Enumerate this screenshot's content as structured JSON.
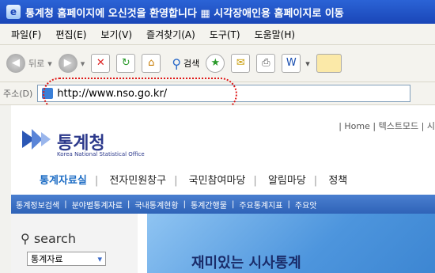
{
  "window": {
    "title": "통계청 홈페이지에 오신것을 환영합니다 ▦ 시각장애인용 홈페이지로 이동"
  },
  "menubar": {
    "items": [
      "파일(F)",
      "편집(E)",
      "보기(V)",
      "즐겨찾기(A)",
      "도구(T)",
      "도움말(H)"
    ]
  },
  "toolbar": {
    "back_label": "뒤로",
    "search_label": "검색"
  },
  "address": {
    "label": "주소(D)",
    "url": "http://www.nso.go.kr/"
  },
  "site": {
    "toplinks": "| Home | 텍스트모드 | 시",
    "logo_name": "통계청",
    "logo_sub": "Korea National Statistical Office",
    "mainnav": [
      "통계자료실",
      "전자민원창구",
      "국민참여마당",
      "알림마당",
      "정책"
    ],
    "subnav": [
      "통계정보검색",
      "분야별통계자료",
      "국내통계현황",
      "통계간행물",
      "주요통계지표",
      "주요앗"
    ],
    "search_label": "search",
    "select_value": "통계자료",
    "banner_text": "재미있는 시사통계"
  }
}
